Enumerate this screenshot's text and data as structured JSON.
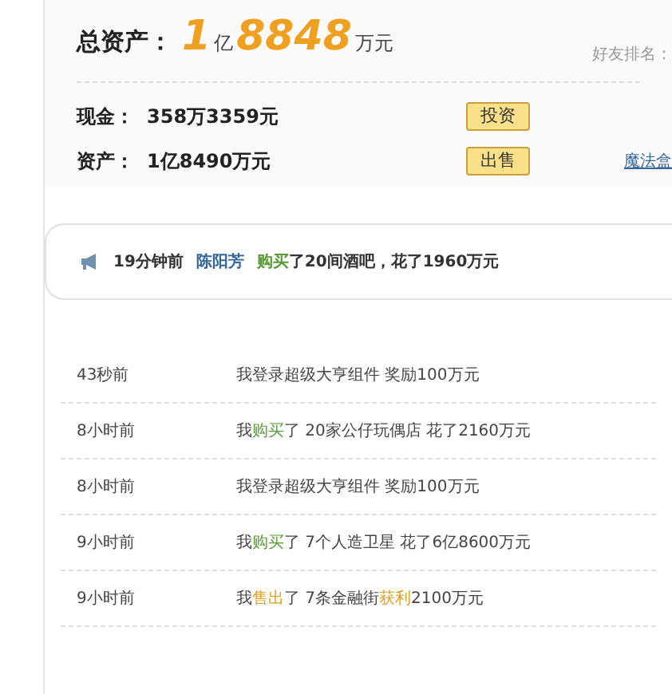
{
  "summary": {
    "label": "总资产：",
    "amount": [
      {
        "kind": "big",
        "text": "1"
      },
      {
        "kind": "unit",
        "text": "亿"
      },
      {
        "kind": "big",
        "text": "8848"
      },
      {
        "kind": "unit",
        "text": "万元"
      }
    ],
    "ranking_label": "好友排名："
  },
  "balances": [
    {
      "label": "现金：",
      "value": "358万3359元",
      "button": "投资"
    },
    {
      "label": "资产：",
      "value": "1亿8490万元",
      "button": "出售",
      "link": "魔法盒"
    }
  ],
  "notice": {
    "time": "19分钟前",
    "name": "陈阳芳",
    "parts": [
      {
        "kind": "buy",
        "text": "购买"
      },
      {
        "kind": "text",
        "text": "了20间酒吧，花了1960万元"
      }
    ]
  },
  "log": [
    {
      "time": "43秒前",
      "parts": [
        {
          "kind": "text",
          "text": "我登录超级大亨组件 奖励100万元"
        }
      ]
    },
    {
      "time": "8小时前",
      "parts": [
        {
          "kind": "text",
          "text": "我"
        },
        {
          "kind": "buy",
          "text": "购买"
        },
        {
          "kind": "text",
          "text": "了 20家公仔玩偶店 花了2160万元"
        }
      ]
    },
    {
      "time": "8小时前",
      "parts": [
        {
          "kind": "text",
          "text": "我登录超级大亨组件 奖励100万元"
        }
      ]
    },
    {
      "time": "9小时前",
      "parts": [
        {
          "kind": "text",
          "text": "我"
        },
        {
          "kind": "buy",
          "text": "购买"
        },
        {
          "kind": "text",
          "text": "了 7个人造卫星 花了6亿8600万元"
        }
      ]
    },
    {
      "time": "9小时前",
      "parts": [
        {
          "kind": "text",
          "text": "我"
        },
        {
          "kind": "sell",
          "text": "售出"
        },
        {
          "kind": "text",
          "text": "了 7条金融街"
        },
        {
          "kind": "sell",
          "text": "获利"
        },
        {
          "kind": "text",
          "text": "2100万元"
        }
      ]
    }
  ]
}
